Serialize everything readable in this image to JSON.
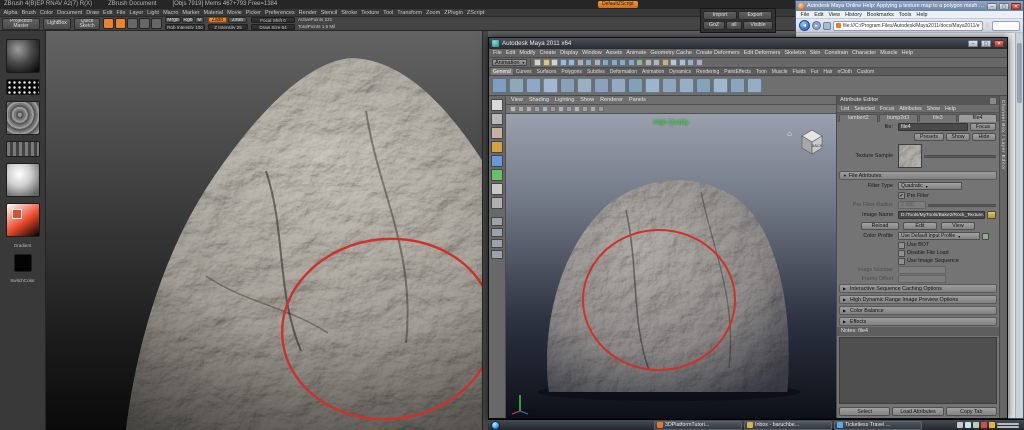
{
  "colors": {
    "annotation_red": "#d03028",
    "zbrush_accent_orange": "#ea8430",
    "viewport_quality_green": "#3ad83a"
  },
  "zbrush": {
    "title": "ZBrush 4(B)EP RNAV A2(7) R(X)",
    "document_title": "ZBrush Document",
    "stats": "[Objs 7919] Mems 467+793 Free=1384",
    "default_zscript": "DefaultZScript",
    "menus": [
      "Alpha",
      "Brush",
      "Color",
      "Document",
      "Draw",
      "Edit",
      "File",
      "Layer",
      "Light",
      "Macro",
      "Marker",
      "Material",
      "Movie",
      "Picker",
      "Preferences",
      "Render",
      "Stencil",
      "Stroke",
      "Texture",
      "Tool",
      "Transform",
      "Zoom",
      "ZPlugin",
      "ZScript"
    ],
    "toolbar": {
      "projection_master": "Projection Master",
      "lightbox": "LightBox",
      "quick_sketch": "Quick Sketch",
      "mrgb": "Mrgb",
      "rgb": "Rgb",
      "m": "M",
      "rgb_intensity": "Rgb Intensity 100",
      "zadd": "Zadd",
      "zsub": "Zsub",
      "z_intensity": "Z Intensity 25",
      "focal_shift": "Focal Shift 0",
      "draw_size": "Draw Size 64",
      "active_points": "ActivePoints 221",
      "total_points": "TotalPoints 1.5 Mil"
    },
    "tool_icons": [
      {
        "name": "edit-object-icon",
        "color": "#ea8430"
      },
      {
        "name": "draw-pointer-icon",
        "color": "#ea8430"
      },
      {
        "name": "move-icon",
        "color": "#676767"
      },
      {
        "name": "scale-icon",
        "color": "#676767"
      },
      {
        "name": "rotate-icon",
        "color": "#676767"
      }
    ],
    "tool_palette": {
      "import": "Import",
      "export": "Export",
      "goz": "GoZ",
      "all": "all",
      "visible": "Visible"
    },
    "sidebar": {
      "gradient_label": "Gradient",
      "switch_color": "SwitchColor"
    }
  },
  "maya": {
    "title": "Autodesk Maya 2011 x64",
    "menus": [
      "File",
      "Edit",
      "Modify",
      "Create",
      "Display",
      "Window",
      "Assets",
      "Animate",
      "Geometry Cache",
      "Create Deformers",
      "Edit Deformers",
      "Skeleton",
      "Skin",
      "Constrain",
      "Character",
      "Muscle",
      "Help"
    ],
    "menu_set": "Animation",
    "status_icons": [
      {
        "name": "new-scene-icon",
        "color": "#cfd3d8"
      },
      {
        "name": "open-scene-icon",
        "color": "#d9c28e"
      },
      {
        "name": "save-scene-icon",
        "color": "#cfd3d8"
      },
      {
        "name": "undo-icon",
        "color": "#9fb7d8"
      },
      {
        "name": "redo-icon",
        "color": "#9fb7d8"
      },
      {
        "name": "select-by-hierarchy-icon",
        "color": "#a8b0b8"
      },
      {
        "name": "select-by-object-icon",
        "color": "#8fa8c0"
      },
      {
        "name": "select-by-component-icon",
        "color": "#a8b0b8"
      },
      {
        "name": "snap-to-grid-icon",
        "color": "#88a8c8"
      },
      {
        "name": "snap-to-curve-icon",
        "color": "#88a8c8"
      },
      {
        "name": "snap-to-point-icon",
        "color": "#88a8c8"
      },
      {
        "name": "snap-to-plane-icon",
        "color": "#88a8c8"
      },
      {
        "name": "make-live-icon",
        "color": "#90b890"
      },
      {
        "name": "input-connections-icon",
        "color": "#b0b4b8"
      },
      {
        "name": "output-connections-icon",
        "color": "#b0b4b8"
      },
      {
        "name": "construction-history-icon",
        "color": "#c0b090"
      },
      {
        "name": "render-view-icon",
        "color": "#b8c8d8"
      },
      {
        "name": "render-current-frame-icon",
        "color": "#a8c0d8"
      },
      {
        "name": "ipr-render-icon",
        "color": "#98b0c8"
      },
      {
        "name": "render-settings-icon",
        "color": "#b0a8c8"
      }
    ],
    "shelf_tabs": [
      "General",
      "Curves",
      "Surfaces",
      "Polygons",
      "Subdivs",
      "Deformation",
      "Animation",
      "Dynamics",
      "Rendering",
      "PaintEffects",
      "Toon",
      "Muscle",
      "Fluids",
      "Fur",
      "Hair",
      "nCloth",
      "Custom"
    ],
    "active_shelf_tab": "General",
    "shelf_icons": [
      {
        "name": "poly-sphere-icon",
        "color": "#7f9fc0"
      },
      {
        "name": "poly-cube-icon",
        "color": "#8fa8b8"
      },
      {
        "name": "poly-cylinder-icon",
        "color": "#90a8c8"
      },
      {
        "name": "poly-cone-icon",
        "color": "#a0b8d0"
      },
      {
        "name": "poly-plane-icon",
        "color": "#88a0b8"
      },
      {
        "name": "poly-torus-icon",
        "color": "#98b0c0"
      },
      {
        "name": "poly-prism-icon",
        "color": "#8aa2ba"
      },
      {
        "name": "poly-pyramid-icon",
        "color": "#92aac2"
      },
      {
        "name": "poly-pipe-icon",
        "color": "#84a0b6"
      },
      {
        "name": "poly-helix-icon",
        "color": "#9cb4cc"
      },
      {
        "name": "poly-soccer-icon",
        "color": "#8ea6be"
      },
      {
        "name": "platonic-solid-icon",
        "color": "#96aec6"
      },
      {
        "name": "nurbs-sphere-icon",
        "color": "#86a2b8"
      },
      {
        "name": "nurbs-cube-icon",
        "color": "#9eb6ce"
      },
      {
        "name": "nurbs-cylinder-icon",
        "color": "#8aa6bc"
      },
      {
        "name": "nurbs-cone-icon",
        "color": "#94acc4"
      }
    ],
    "toolbox_icons": [
      {
        "name": "select-tool-icon",
        "color": "#d8d8d8"
      },
      {
        "name": "lasso-tool-icon",
        "color": "#b8b8b8"
      },
      {
        "name": "paint-select-tool-icon",
        "color": "#c8b0a0"
      },
      {
        "name": "move-tool-icon",
        "color": "#d8a040"
      },
      {
        "name": "rotate-tool-icon",
        "color": "#6898d8"
      },
      {
        "name": "scale-tool-icon",
        "color": "#68c068"
      },
      {
        "name": "universal-manipulator-icon",
        "color": "#c8c8c8"
      },
      {
        "name": "soft-modification-icon",
        "color": "#b0b0b0"
      }
    ],
    "layout_icons": [
      {
        "name": "layout-single-pane-icon",
        "color": "#9aa2aa"
      },
      {
        "name": "layout-four-pane-icon",
        "color": "#9aa2aa"
      },
      {
        "name": "layout-persp-outliner-icon",
        "color": "#9aa2aa"
      },
      {
        "name": "layout-hypershade-pane-icon",
        "color": "#9aa2aa"
      }
    ],
    "panel_menus": [
      "View",
      "Shading",
      "Lighting",
      "Show",
      "Renderer",
      "Panels"
    ],
    "viewport_icons": [
      {
        "name": "select-camera-icon",
        "color": "#b8b8b8"
      },
      {
        "name": "lock-camera-icon",
        "color": "#a8a8a8"
      },
      {
        "name": "camera-attributes-icon",
        "color": "#b0b0b0"
      },
      {
        "name": "bookmark-icon",
        "color": "#9aa4ae"
      },
      {
        "name": "image-plane-icon",
        "color": "#a8b0b8"
      },
      {
        "name": "two-panes-icon",
        "color": "#9a9a9a"
      },
      {
        "name": "grid-icon",
        "color": "#aab2ba"
      },
      {
        "name": "film-gate-icon",
        "color": "#9aa2aa"
      },
      {
        "name": "resolution-gate-icon",
        "color": "#b2b2b2"
      },
      {
        "name": "gate-mask-icon",
        "color": "#a2a2a2"
      },
      {
        "name": "field-chart-icon",
        "color": "#aaaaaa"
      },
      {
        "name": "safe-action-icon",
        "color": "#9a9a9a"
      }
    ],
    "viewport": {
      "quality_label": "High Quality",
      "cube_face": "BACK"
    },
    "attribute_editor": {
      "title": "Attribute Editor",
      "menus": [
        "List",
        "Selected",
        "Focus",
        "Attributes",
        "Show",
        "Help"
      ],
      "tabs": [
        "lambert2",
        "bump2d3",
        "file3",
        "file4"
      ],
      "active_tab": "file4",
      "node_type_label": "file:",
      "node_name": "file4",
      "focus_button": "Focus",
      "presets_button": "Presets",
      "show_button": "Show",
      "hide_button": "Hide",
      "texture_sample_label": "Texture Sample",
      "file_attributes": {
        "section_label": "File Attributes",
        "filter_type_label": "Filter Type",
        "filter_type_value": "Quadratic",
        "pre_filter_label": "Pre Filter",
        "pre_filter_radius_label": "Pre Filter Radius",
        "pre_filter_radius_value": "2.000",
        "image_name_label": "Image Name",
        "image_name_value": "D:/Tools/MyTools/Bake2/Rock_Texture.tif",
        "reload_button": "Reload",
        "edit_button": "Edit",
        "view_button": "View",
        "color_profile_label": "Color Profile",
        "color_profile_value": "Use Default Input Profile",
        "use_bot_label": "Use BOT",
        "disable_file_load_label": "Disable File Load",
        "use_image_sequence_label": "Use Image Sequence",
        "image_number_label": "Image Number",
        "frame_offset_label": "Frame Offset"
      },
      "collapsed_sections": [
        "Interactive Sequence Caching Options",
        "High Dynamic Range Image Preview Options",
        "Color Balance",
        "Effects"
      ],
      "notes_label": "Notes: file4",
      "select_button": "Select",
      "load_attributes_button": "Load Attributes",
      "copy_tab_button": "Copy Tab"
    },
    "right_dock_tab": "Channel Box / Layer Editor"
  },
  "firefox": {
    "title": "Autodesk Maya Online Help: Applying a texture map to a polygon mesh - Mozilla Firefox",
    "menus": [
      "File",
      "Edit",
      "View",
      "History",
      "Bookmarks",
      "Tools",
      "Help"
    ],
    "address": "file:///C:/Program Files/Autodesk/Maya2011/docs/Maya2011/e"
  },
  "taskbar": {
    "buttons": [
      {
        "name": "taskbar-button-3dplatform",
        "label": "3DPlatformTutori...",
        "color": "#e07a28"
      },
      {
        "name": "taskbar-button-outlook-inbox",
        "label": "Inbox - baruchbe...",
        "color": "#d8b544"
      },
      {
        "name": "taskbar-button-ticketless-travel",
        "label": "Ticketless Travel ...",
        "color": "#5aaede"
      }
    ],
    "tray_icons": [
      {
        "name": "tray-show-hidden-icon",
        "color": "#c8c8c8"
      },
      {
        "name": "tray-volume-icon",
        "color": "#cfe0f0"
      },
      {
        "name": "tray-network-icon",
        "color": "#b8d0b8"
      },
      {
        "name": "tray-antivirus-icon",
        "color": "#d05048"
      },
      {
        "name": "tray-update-icon",
        "color": "#e8b040"
      }
    ]
  }
}
